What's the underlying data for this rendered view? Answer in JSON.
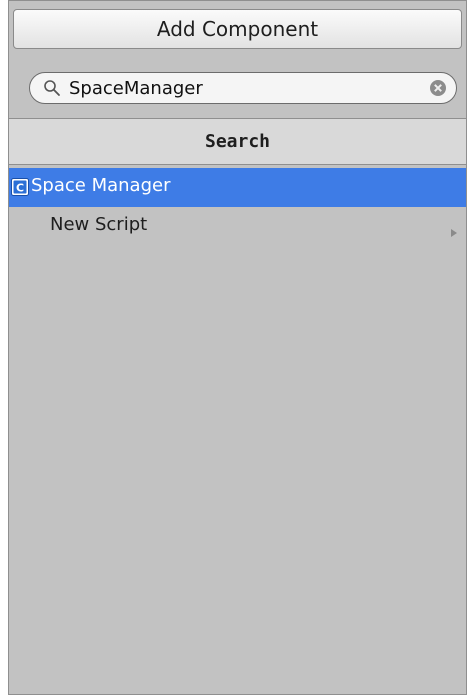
{
  "add_component": {
    "label": "Add Component"
  },
  "search": {
    "value": "SpaceManager",
    "icon": "search-icon",
    "clear_icon": "clear-icon"
  },
  "section": {
    "title": "Search"
  },
  "results": [
    {
      "label": "Space Manager",
      "icon": "csharp-script-icon",
      "selected": true
    },
    {
      "label": "New Script",
      "icon": "submenu-arrow-icon",
      "selected": false
    }
  ],
  "colors": {
    "selection": "#3e7ce6",
    "panel_background": "#c2c2c2",
    "header_background": "#d9d9d9"
  }
}
